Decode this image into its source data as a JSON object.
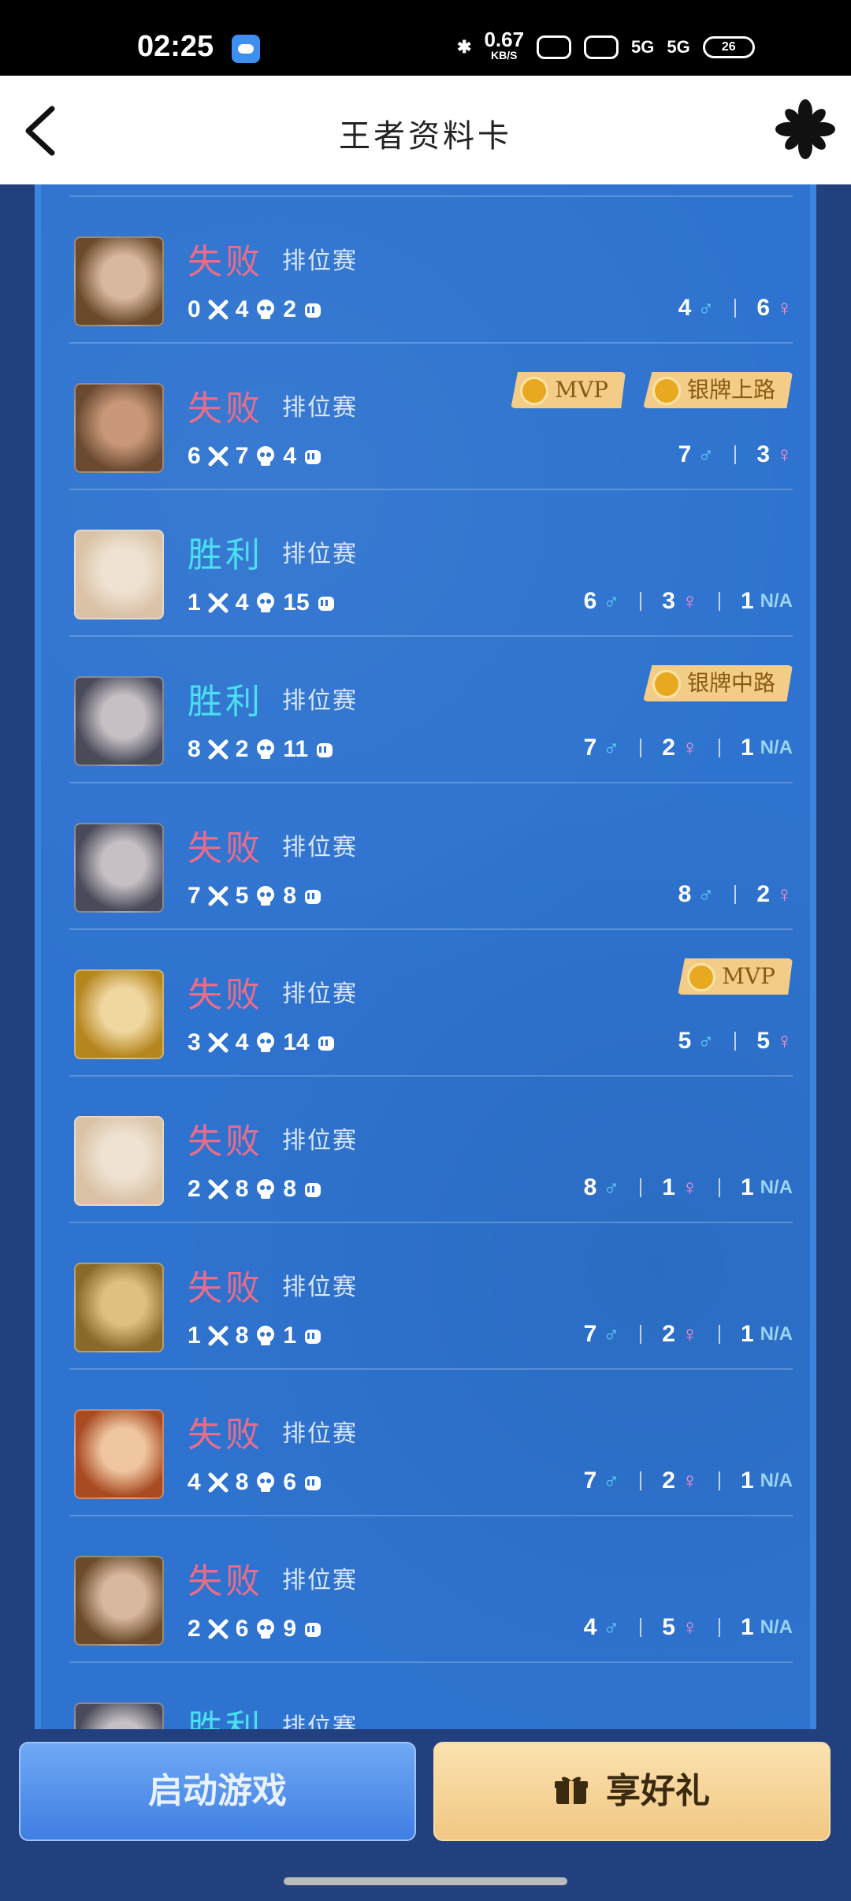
{
  "status_bar": {
    "time": "02:25",
    "net_speed_value": "0.67",
    "net_speed_unit": "KB/S",
    "signal_label_1": "5G",
    "signal_label_2": "5G",
    "battery": "26"
  },
  "header": {
    "title": "王者资料卡"
  },
  "legend_icons": {
    "male": "♂",
    "female": "♀"
  },
  "matches": [
    {
      "result": "失败",
      "mode": "排位赛",
      "k": "0",
      "d": "4",
      "a": "2",
      "badges": [],
      "male": "4",
      "female": "6",
      "na": null,
      "avatar_colors": [
        "#6a4a2a",
        "#d9b8a0"
      ]
    },
    {
      "result": "失败",
      "mode": "排位赛",
      "k": "6",
      "d": "7",
      "a": "4",
      "badges": [
        "MVP",
        "银牌上路"
      ],
      "male": "7",
      "female": "3",
      "na": null,
      "avatar_colors": [
        "#6b4a32",
        "#c99878"
      ]
    },
    {
      "result": "胜利",
      "mode": "排位赛",
      "k": "1",
      "d": "4",
      "a": "15",
      "badges": [],
      "male": "6",
      "female": "3",
      "na": "1",
      "avatar_colors": [
        "#d9c2a6",
        "#efe2d2"
      ]
    },
    {
      "result": "胜利",
      "mode": "排位赛",
      "k": "8",
      "d": "2",
      "a": "11",
      "badges": [
        "银牌中路"
      ],
      "male": "7",
      "female": "2",
      "na": "1",
      "avatar_colors": [
        "#4a4b5a",
        "#c6c0c4"
      ]
    },
    {
      "result": "失败",
      "mode": "排位赛",
      "k": "7",
      "d": "5",
      "a": "8",
      "badges": [],
      "male": "8",
      "female": "2",
      "na": null,
      "avatar_colors": [
        "#4a4b5a",
        "#c6c0c4"
      ]
    },
    {
      "result": "失败",
      "mode": "排位赛",
      "k": "3",
      "d": "4",
      "a": "14",
      "badges": [
        "MVP"
      ],
      "male": "5",
      "female": "5",
      "na": null,
      "avatar_colors": [
        "#b5861e",
        "#f0d7a0"
      ]
    },
    {
      "result": "失败",
      "mode": "排位赛",
      "k": "2",
      "d": "8",
      "a": "8",
      "badges": [],
      "male": "8",
      "female": "1",
      "na": "1",
      "avatar_colors": [
        "#d9c2a6",
        "#efe2d2"
      ]
    },
    {
      "result": "失败",
      "mode": "排位赛",
      "k": "1",
      "d": "8",
      "a": "1",
      "badges": [],
      "male": "7",
      "female": "2",
      "na": "1",
      "avatar_colors": [
        "#8a6a2a",
        "#e0c080"
      ]
    },
    {
      "result": "失败",
      "mode": "排位赛",
      "k": "4",
      "d": "8",
      "a": "6",
      "badges": [],
      "male": "7",
      "female": "2",
      "na": "1",
      "avatar_colors": [
        "#a84a22",
        "#efc6a0"
      ]
    },
    {
      "result": "失败",
      "mode": "排位赛",
      "k": "2",
      "d": "6",
      "a": "9",
      "badges": [],
      "male": "4",
      "female": "5",
      "na": "1",
      "avatar_colors": [
        "#6a4a2a",
        "#d9b8a0"
      ]
    },
    {
      "result": "胜利",
      "mode": "排位赛",
      "k": "",
      "d": "",
      "a": "",
      "badges": [],
      "male": "",
      "female": "",
      "na": null,
      "avatar_colors": [
        "#4a4b5a",
        "#c6c0c4"
      ]
    }
  ],
  "na_label": "N/A",
  "bottom": {
    "launch_label": "启动游戏",
    "gift_label": "享好礼"
  },
  "colors": {
    "lose": "#e96d8a",
    "win": "#4ae0f0",
    "card_bg": "#2e73cf",
    "page_bg": "#23407e"
  }
}
